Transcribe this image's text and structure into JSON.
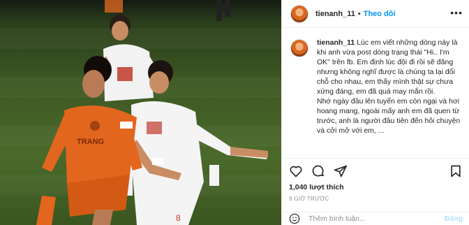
{
  "header": {
    "username": "tienanh_11",
    "separator": "•",
    "follow_label": "Theo dõi",
    "more_icon": "more-horizontal-icon"
  },
  "caption": {
    "username": "tienanh_11",
    "text": "Lúc em viết những dòng này là khi anh vừa post dòng trạng thái \"Hi.. I'm OK\" trên fb. Em định lúc đội đi rồi sẽ đăng nhưng không nghĩ được là chúng ta lại đổi chỗ cho nhau, em thấy mình thật sự chưa xứng đáng, em đã quá may mắn rồi.\nNhớ ngày đầu lên tuyển em còn ngại và hơi hoang mang, ngoài mấy anh em đã quen từ trước, anh là người đầu tiên đến hỏi chuyện và cởi mở với em, ..."
  },
  "actions": {
    "like_icon": "heart-icon",
    "comment_icon": "comment-icon",
    "share_icon": "share-icon",
    "save_icon": "bookmark-icon",
    "likes": "1,040 lượt thích",
    "time": "9 GIỜ TRƯỚC"
  },
  "comment_box": {
    "placeholder": "Thêm bình luận...",
    "post_label": "Đăng"
  },
  "colors": {
    "accent": "#0095f6",
    "orange_kit": "#e3661e",
    "white_kit": "#f4f4f4",
    "pitch": "#466626"
  }
}
